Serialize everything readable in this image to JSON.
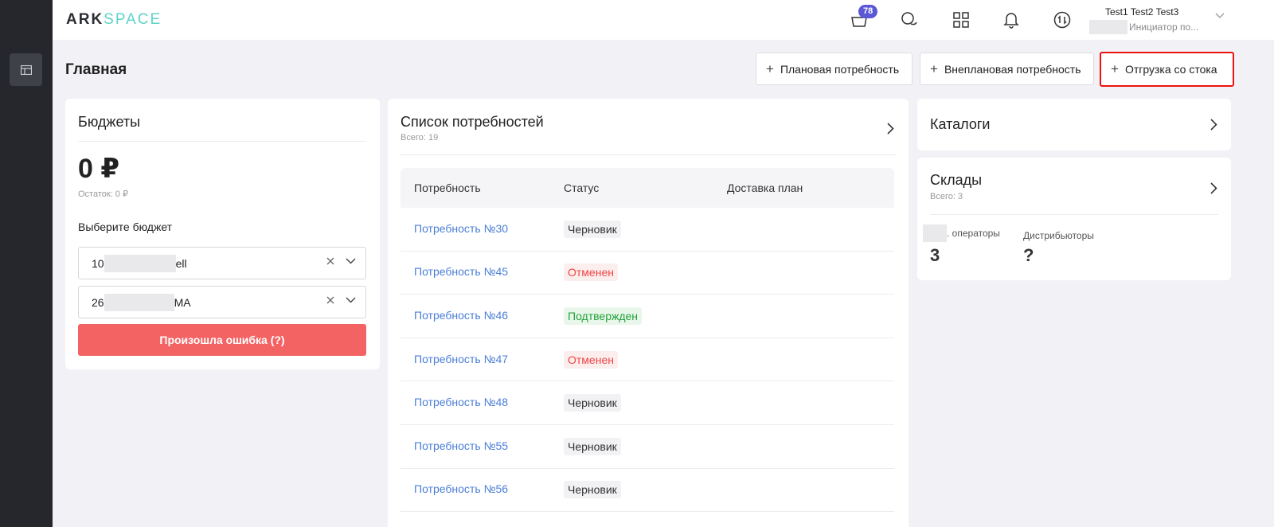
{
  "topbar": {
    "logo_ark": "ARK",
    "logo_space": "SPACE",
    "cart_badge": "78",
    "user_name": "Test1 Test2 Test3",
    "user_role": "Инициатор по..."
  },
  "header": {
    "title": "Главная",
    "btn_planned": "Плановая потребность",
    "btn_unplanned": "Внеплановая потребность",
    "btn_stock": "Отгрузка со стока"
  },
  "budgets": {
    "title": "Бюджеты",
    "amount": "0 ₽",
    "remainder": "Остаток: 0 ₽",
    "select_label": "Выберите бюджет",
    "select1_prefix": "10",
    "select1_suffix": "ell",
    "select2_prefix": "26",
    "select2_suffix": "MA",
    "error_button": "Произошла ошибка (?)"
  },
  "needs": {
    "title": "Список потребностей",
    "total": "Всего: 19",
    "columns": [
      "Потребность",
      "Статус",
      "Доставка план"
    ],
    "rows": [
      {
        "name": "Потребность №30",
        "status": "Черновик",
        "kind": "draft"
      },
      {
        "name": "Потребность №45",
        "status": "Отменен",
        "kind": "cancel"
      },
      {
        "name": "Потребность №46",
        "status": "Подтвержден",
        "kind": "ok"
      },
      {
        "name": "Потребность №47",
        "status": "Отменен",
        "kind": "cancel"
      },
      {
        "name": "Потребность №48",
        "status": "Черновик",
        "kind": "draft"
      },
      {
        "name": "Потребность №55",
        "status": "Черновик",
        "kind": "draft"
      },
      {
        "name": "Потребность №56",
        "status": "Черновик",
        "kind": "draft"
      }
    ]
  },
  "catalogs": {
    "title": "Каталоги"
  },
  "warehouses": {
    "title": "Склады",
    "total": "Всего: 3",
    "operators_label": ". операторы",
    "operators_value": "3",
    "distributors_label": "Дистрибьюторы",
    "distributors_value": "?"
  },
  "colors": {
    "accent": "#5b58d6",
    "link": "#4a7ed8",
    "error": "#f46364",
    "sidebar": "#25272c",
    "highlight": "#ee1111"
  }
}
